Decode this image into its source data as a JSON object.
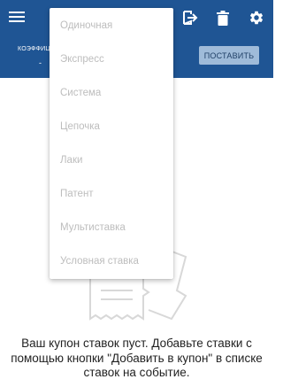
{
  "colors": {
    "appbar": "#1f5594",
    "place_button_bg": "#9fbbd9",
    "menu_text_disabled": "#bdbdbd",
    "body_text": "#222222"
  },
  "appbar": {
    "icons": [
      "menu-icon",
      "exit-icon",
      "trash-icon",
      "gear-icon"
    ],
    "coef_label": "КОЭФФИЦИЕНТ",
    "coef_value": "-",
    "place_button": "ПОСТАВИТЬ"
  },
  "dropdown": {
    "items": [
      {
        "label": "Одиночная"
      },
      {
        "label": "Экспресс"
      },
      {
        "label": "Система"
      },
      {
        "label": "Цепочка"
      },
      {
        "label": "Лаки"
      },
      {
        "label": "Патент"
      },
      {
        "label": "Мультиставка"
      },
      {
        "label": "Условная ставка"
      }
    ]
  },
  "empty_state": {
    "message": "Ваш купон ставок пуст. Добавьте ставки с помощью кнопки \"Добавить в купон\" в списке ставок на событие."
  }
}
